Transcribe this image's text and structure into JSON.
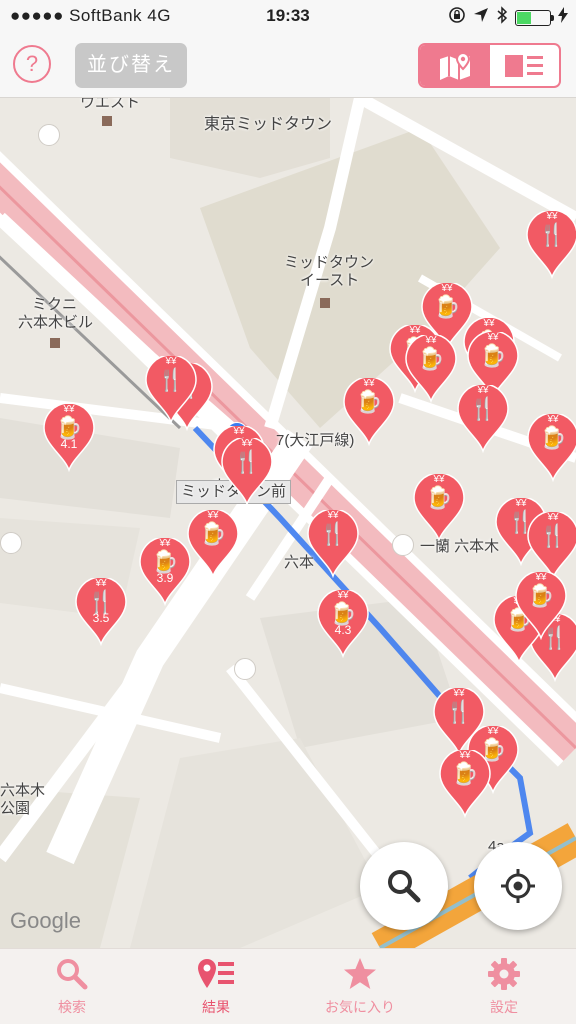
{
  "status": {
    "carrier": "●●●●● SoftBank",
    "network": "4G",
    "time": "19:33",
    "battery_level": 0.4
  },
  "toolbar": {
    "help_label": "?",
    "sort_label": "並び替え",
    "view_mode": "map"
  },
  "map": {
    "labels": [
      {
        "text": "ウエスト"
      },
      {
        "text": "東京ミッドタウン"
      },
      {
        "text": "ミッドタウン"
      },
      {
        "text": "イースト"
      },
      {
        "text": "ミクニ"
      },
      {
        "text": "六本木ビル"
      },
      {
        "text": "7(大江戸線)"
      },
      {
        "text": "東"
      },
      {
        "text": "ミッドタ　ン前"
      },
      {
        "text": "六本"
      },
      {
        "text": "一蘭 六本木"
      },
      {
        "text": "六本木"
      },
      {
        "text": "公園"
      },
      {
        "text": "4a"
      }
    ],
    "pins": [
      {
        "type": "food",
        "price": "¥¥",
        "score": ""
      },
      {
        "type": "drink",
        "price": "¥¥",
        "score": ""
      },
      {
        "type": "drink",
        "price": "¥¥",
        "score": ""
      },
      {
        "type": "drink",
        "price": "¥¥",
        "score": ""
      },
      {
        "type": "drink",
        "price": "¥¥",
        "score": ""
      },
      {
        "type": "drink",
        "price": "¥¥",
        "score": ""
      },
      {
        "type": "food",
        "price": "¥¥",
        "score": ""
      },
      {
        "type": "drink",
        "price": "¥¥",
        "score": "4.1"
      },
      {
        "type": "drink",
        "price": "¥¥",
        "score": ""
      },
      {
        "type": "food",
        "price": "¥",
        "score": ""
      },
      {
        "type": "food",
        "price": "¥¥",
        "score": ""
      },
      {
        "type": "food",
        "price": "¥¥",
        "score": ""
      },
      {
        "type": "drink",
        "price": "¥¥",
        "score": ""
      },
      {
        "type": "food",
        "price": "¥¥",
        "score": ""
      },
      {
        "type": "drink",
        "price": "¥¥",
        "score": ""
      },
      {
        "type": "drink",
        "price": "¥¥",
        "score": "3.9"
      },
      {
        "type": "food",
        "price": "¥¥",
        "score": "3.5"
      },
      {
        "type": "food",
        "price": "¥¥",
        "score": ""
      },
      {
        "type": "drink",
        "price": "¥¥",
        "score": "4.3"
      },
      {
        "type": "food",
        "price": "¥¥",
        "score": ""
      },
      {
        "type": "drink",
        "price": "¥¥",
        "score": ""
      },
      {
        "type": "food",
        "price": "¥¥",
        "score": ""
      },
      {
        "type": "drink",
        "price": "¥¥",
        "score": ""
      },
      {
        "type": "drink",
        "price": "¥¥",
        "score": ""
      },
      {
        "type": "food",
        "price": "¥¥",
        "score": ""
      },
      {
        "type": "food",
        "price": "¥¥",
        "score": ""
      },
      {
        "type": "drink",
        "price": "¥¥",
        "score": ""
      },
      {
        "type": "drink",
        "price": "¥¥",
        "score": ""
      }
    ],
    "google_logo": "Google"
  },
  "fabs": {
    "search_icon": "magnifier-icon",
    "locate_icon": "crosshair-icon"
  },
  "tabs": [
    {
      "label": "検索",
      "icon": "search-icon",
      "active": false
    },
    {
      "label": "結果",
      "icon": "pin-list-icon",
      "active": true
    },
    {
      "label": "お気に入り",
      "icon": "star-icon",
      "active": false
    },
    {
      "label": "設定",
      "icon": "gear-icon",
      "active": false
    }
  ],
  "colors": {
    "accent": "#ef7a8f",
    "pin": "#f25a64",
    "route": "#3d7cf0"
  }
}
